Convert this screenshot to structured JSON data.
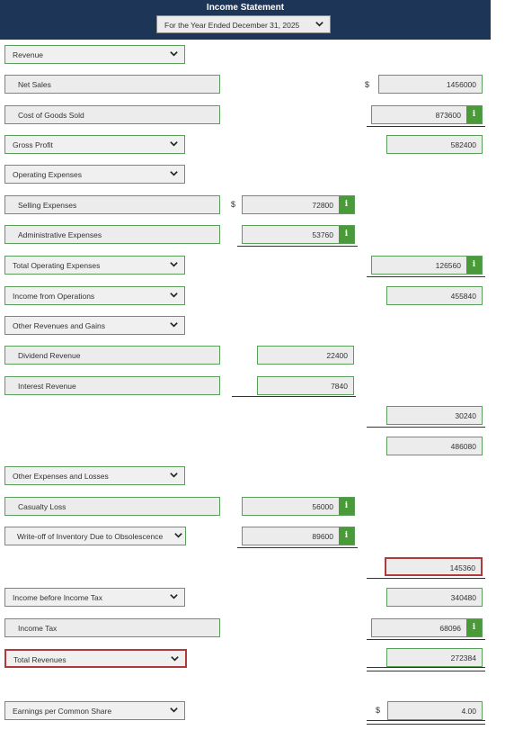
{
  "header": {
    "title": "Income Statement",
    "period": "For the Year Ended December 31, 2025"
  },
  "currency_symbol": "$",
  "rows": {
    "revenue_sel": "Revenue",
    "net_sales_label": "Net Sales",
    "net_sales_value": "1456000",
    "cogs_label": "Cost of Goods Sold",
    "cogs_value": "873600",
    "gross_profit_sel": "Gross Profit",
    "gross_profit_value": "582400",
    "opex_sel": "Operating Expenses",
    "selling_label": "Selling Expenses",
    "selling_value": "72800",
    "admin_label": "Administrative Expenses",
    "admin_value": "53760",
    "total_opex_sel": "Total Operating Expenses",
    "total_opex_value": "126560",
    "income_ops_sel": "Income from Operations",
    "income_ops_value": "455840",
    "other_rev_sel": "Other Revenues and Gains",
    "dividend_label": "Dividend Revenue",
    "dividend_value": "22400",
    "interest_label": "Interest Revenue",
    "interest_value": "7840",
    "other_rev_total": "30240",
    "subtotal_value": "486080",
    "other_exp_sel": "Other Expenses and Losses",
    "casualty_label": "Casualty Loss",
    "casualty_value": "56000",
    "writeoff_label": "Write-off of Inventory Due to Obsolescence",
    "writeoff_value": "89600",
    "other_exp_total": "145360",
    "income_before_tax_sel": "Income before Income Tax",
    "income_before_tax_value": "340480",
    "income_tax_label": "Income Tax",
    "income_tax_value": "68096",
    "total_rev_sel": "Total Revenues",
    "total_rev_value": "272384",
    "eps_sel": "Earnings per Common Share",
    "eps_value": "4.00"
  },
  "info_glyph": "i",
  "colors": {
    "header_bg": "#1d3557",
    "border_green": "#5a9e5a",
    "error_red": "#b03a3a",
    "info_green": "#4a9a3a"
  }
}
